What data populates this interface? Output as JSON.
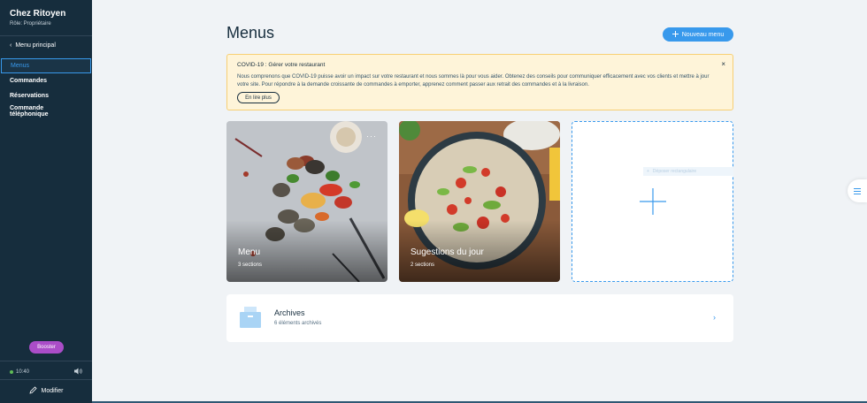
{
  "sidebar": {
    "restaurant_name": "Chez Ritoyen",
    "role": "Rôle: Propriétaire",
    "back_label": "Menu principal",
    "items": [
      {
        "label": "Menus",
        "active": true
      },
      {
        "label": "Commandes",
        "active": false
      },
      {
        "label": "Réservations",
        "active": false
      },
      {
        "label": "Commande téléphonique",
        "active": false
      }
    ],
    "booster_label": "Booster",
    "time": "10:40",
    "modify_label": "Modifier"
  },
  "header": {
    "title": "Menus",
    "new_menu_label": "Nouveau menu"
  },
  "notice": {
    "title": "COVID-19 : Gérer votre restaurant",
    "body": "Nous comprenons que COVID-19 puisse avoir un impact sur votre restaurant et nous sommes là pour vous aider. Obtenez des conseils pour communiquer efficacement avec vos clients et mettre à jour votre site. Pour répondre à la demande croissante de commandes à emporter, apprenez comment passer aux retrait des commandes et à la livraison.",
    "read_more_label": "En lire plus",
    "close_glyph": "×"
  },
  "menu_cards": [
    {
      "title": "Menu",
      "subtitle": "3 sections",
      "more_glyph": "···"
    },
    {
      "title": "Sugestions du jour",
      "subtitle": "2 sections"
    }
  ],
  "add_card": {
    "hint_label": "Déposer rectangulaire"
  },
  "archives": {
    "title": "Archives",
    "subtitle": "6 éléments archivés",
    "chevron": "›"
  },
  "colors": {
    "sidebar_bg": "#162d3d",
    "accent": "#3899ec",
    "booster": "#aa4dc8",
    "notice_bg": "#fef4d9",
    "notice_border": "#f7cf73",
    "page_bg": "#f0f3f6"
  },
  "icons": {
    "back": "chevron-left-icon",
    "volume": "speaker-icon",
    "modify": "pencil-icon",
    "add": "plus-icon",
    "archive": "archive-box-icon",
    "side_tab": "list-icon"
  }
}
